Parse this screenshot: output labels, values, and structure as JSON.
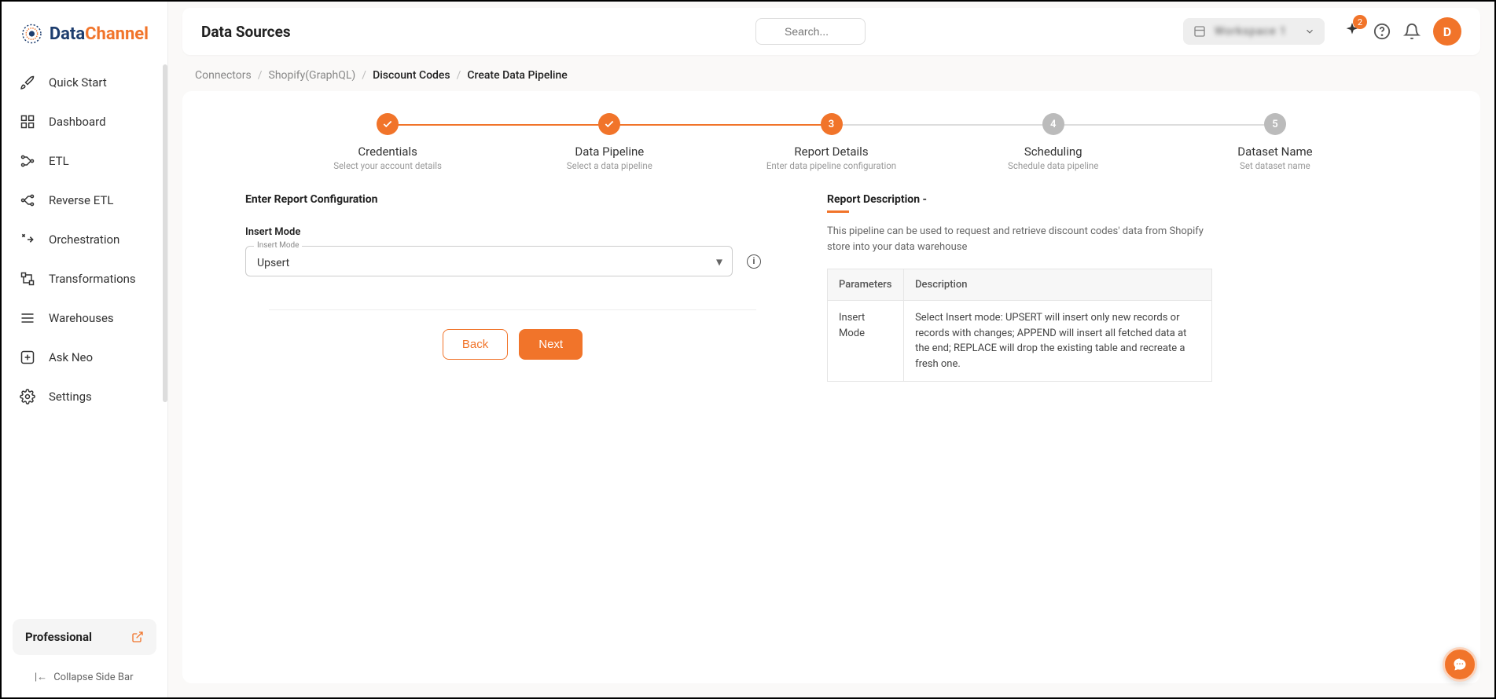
{
  "brand": {
    "name1": "Data",
    "name2": "Channel"
  },
  "sidebar": {
    "items": [
      {
        "label": "Quick Start"
      },
      {
        "label": "Dashboard"
      },
      {
        "label": "ETL"
      },
      {
        "label": "Reverse ETL"
      },
      {
        "label": "Orchestration"
      },
      {
        "label": "Transformations"
      },
      {
        "label": "Warehouses"
      },
      {
        "label": "Ask Neo"
      },
      {
        "label": "Settings"
      }
    ],
    "plan": "Professional",
    "collapse": "Collapse Side Bar"
  },
  "topbar": {
    "title": "Data Sources",
    "search_placeholder": "Search...",
    "workspace": "Workspace 1",
    "badge_count": "2",
    "avatar_initial": "D"
  },
  "breadcrumb": {
    "items": [
      "Connectors",
      "Shopify(GraphQL)",
      "Discount Codes",
      "Create Data Pipeline"
    ]
  },
  "stepper": [
    {
      "title": "Credentials",
      "sub": "Select your account details",
      "state": "done",
      "mark": "✓"
    },
    {
      "title": "Data Pipeline",
      "sub": "Select a data pipeline",
      "state": "done",
      "mark": "✓"
    },
    {
      "title": "Report Details",
      "sub": "Enter data pipeline configuration",
      "state": "active",
      "mark": "3"
    },
    {
      "title": "Scheduling",
      "sub": "Schedule data pipeline",
      "state": "pending",
      "mark": "4"
    },
    {
      "title": "Dataset Name",
      "sub": "Set dataset name",
      "state": "pending",
      "mark": "5"
    }
  ],
  "form": {
    "section_title": "Enter Report Configuration",
    "field_label": "Insert Mode",
    "select_legend": "Insert Mode",
    "select_value": "Upsert",
    "back": "Back",
    "next": "Next"
  },
  "description": {
    "title": "Report Description -",
    "text": "This pipeline can be used to request and retrieve discount codes' data from Shopify store into your data warehouse",
    "table": {
      "headers": [
        "Parameters",
        "Description"
      ],
      "rows": [
        {
          "param": "Insert Mode",
          "desc": "Select Insert mode: UPSERT will insert only new records or records with changes; APPEND will insert all fetched data at the end; REPLACE will drop the existing table and recreate a fresh one."
        }
      ]
    }
  }
}
